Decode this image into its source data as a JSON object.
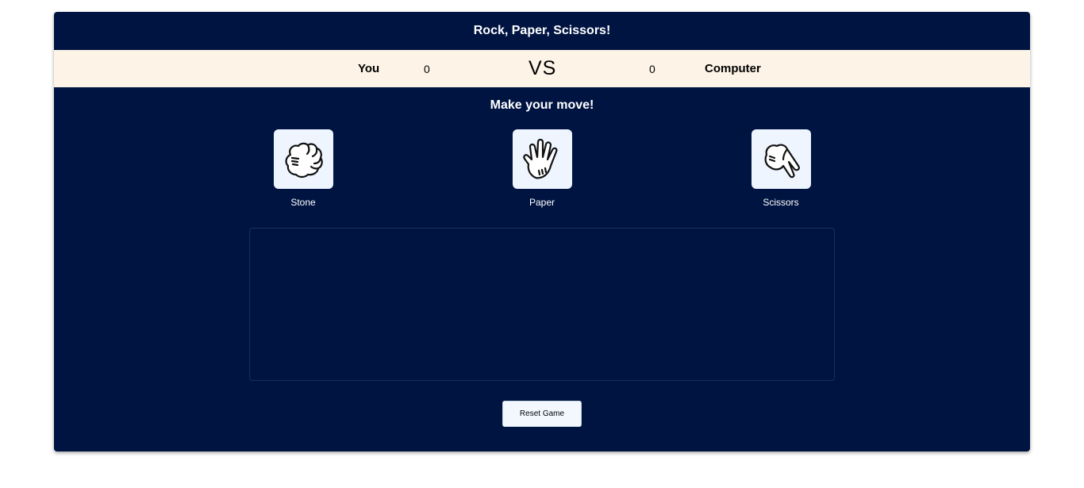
{
  "header": {
    "title": "Rock, Paper, Scissors!"
  },
  "scoreboard": {
    "player_label": "You",
    "player_score": "0",
    "vs_label": "VS",
    "computer_score": "0",
    "computer_label": "Computer"
  },
  "prompt": "Make your move!",
  "choices": [
    {
      "label": "Stone",
      "icon": "fist-icon"
    },
    {
      "label": "Paper",
      "icon": "open-hand-icon"
    },
    {
      "label": "Scissors",
      "icon": "scissors-hand-icon"
    }
  ],
  "result": {
    "text": ""
  },
  "reset_label": "Reset Game",
  "colors": {
    "background": "#001442",
    "score_bar": "#fdf4e7",
    "tile": "#eef5ff",
    "text_light": "#ffffff"
  }
}
